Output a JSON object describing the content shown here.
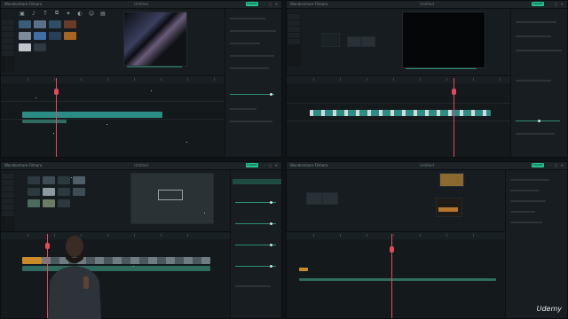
{
  "quadrants": {
    "q1": {
      "app_title": "Wondershare Filmora",
      "export_label": "Export",
      "project_label": "Untitled"
    },
    "q2": {
      "app_title": "Wondershare Filmora",
      "export_label": "Export",
      "project_label": "Untitled"
    },
    "q3": {
      "app_title": "Wondershare Filmora",
      "export_label": "Export",
      "project_label": "Untitled"
    },
    "q4": {
      "app_title": "Wondershare Filmora",
      "export_label": "Export",
      "project_label": "Untitled"
    }
  },
  "watermark": "Udemy",
  "colors": {
    "accent": "#25c28e",
    "playhead": "#e24a5a",
    "panel": "#171c20",
    "video_clip": "#2b8d86",
    "audio_clip": "#2f6b5e",
    "title_clip": "#c98a2a"
  },
  "icons": {
    "toolbar": [
      "media-icon",
      "audio-icon",
      "titles-icon",
      "transitions-icon",
      "effects-icon",
      "filters-icon",
      "stickers-icon",
      "templates-icon"
    ]
  }
}
